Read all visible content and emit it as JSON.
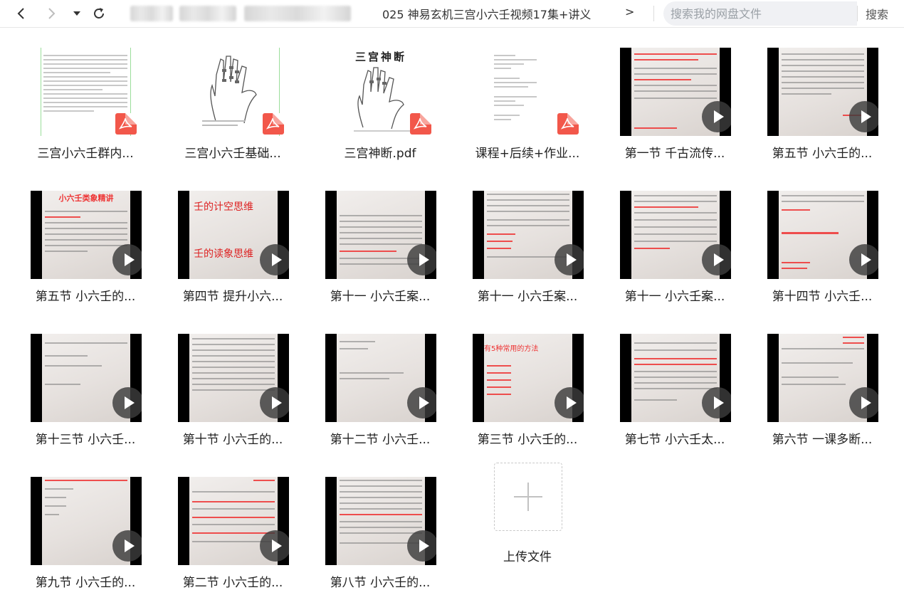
{
  "toolbar": {
    "breadcrumb": "025 神易玄机三宫小六壬视频17集+讲义",
    "breadcrumb_more": ">",
    "search_placeholder": "搜索我的网盘文件",
    "search_button": "搜索"
  },
  "files": [
    {
      "name": "三宫小六壬群内...",
      "type": "pdf",
      "thumb": "text-page"
    },
    {
      "name": "三宫小六壬基础...",
      "type": "pdf",
      "thumb": "hand"
    },
    {
      "name": "三宫神断.pdf",
      "type": "pdf",
      "thumb": "hand-title",
      "thumb_title": "三宫神断"
    },
    {
      "name": "课程+后续+作业...",
      "type": "pdf",
      "thumb": "text-sparse"
    },
    {
      "name": "第一节 千古流传...",
      "type": "video"
    },
    {
      "name": "第五节 小六壬的...",
      "type": "video"
    },
    {
      "name": "第五节 小六壬的...",
      "type": "video",
      "thumb_title": "小六壬类象精讲"
    },
    {
      "name": "第四节 提升小六...",
      "type": "video",
      "thumb_lines": [
        "壬的计空思维",
        "壬的读象思维"
      ]
    },
    {
      "name": "第十一 小六壬案...",
      "type": "video"
    },
    {
      "name": "第十一 小六壬案...",
      "type": "video"
    },
    {
      "name": "第十一 小六壬案...",
      "type": "video"
    },
    {
      "name": "第十四节 小六壬...",
      "type": "video"
    },
    {
      "name": "第十三节 小六壬...",
      "type": "video"
    },
    {
      "name": "第十节 小六壬的...",
      "type": "video"
    },
    {
      "name": "第十二节 小六壬...",
      "type": "video"
    },
    {
      "name": "第三节 小六壬的...",
      "type": "video",
      "thumb_title": "有5种常用的方法"
    },
    {
      "name": "第七节 小六壬太...",
      "type": "video"
    },
    {
      "name": "第六节 一课多断...",
      "type": "video"
    },
    {
      "name": "第九节 小六壬的...",
      "type": "video"
    },
    {
      "name": "第二节 小六壬的...",
      "type": "video"
    },
    {
      "name": "第八节 小六壬的...",
      "type": "video"
    }
  ],
  "upload": {
    "label": "上传文件"
  },
  "colors": {
    "pdf_badge": "#f2574a",
    "search_bg": "#f0f1f4",
    "accent_red": "#e33333"
  }
}
